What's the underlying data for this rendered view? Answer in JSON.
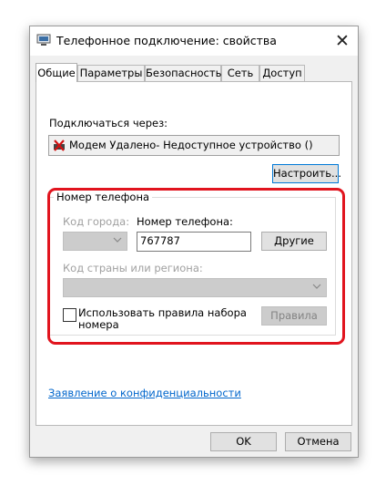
{
  "window": {
    "title": "Телефонное подключение: свойства",
    "close_glyph": "✕"
  },
  "tabs": [
    {
      "label": "Общие",
      "active": true
    },
    {
      "label": "Параметры",
      "active": false
    },
    {
      "label": "Безопасность",
      "active": false
    },
    {
      "label": "Сеть",
      "active": false
    },
    {
      "label": "Доступ",
      "active": false
    }
  ],
  "general": {
    "connect_via_label": "Подключаться через:",
    "device": "Модем Удалено- Недоступное устройство ()",
    "configure_button": "Настроить...",
    "phone_group": {
      "title": "Номер телефона",
      "area_code_label": "Код города:",
      "area_code_value": "",
      "phone_label": "Номер телефона:",
      "phone_value": "767787",
      "alternates_button": "Другие",
      "country_label": "Код страны или региона:",
      "country_value": "",
      "dialing_rules_checkbox": "Использовать правила набора номера",
      "dialing_rules_line1": "Использовать правила набора",
      "dialing_rules_line2": "номера",
      "dialing_rules_checked": false,
      "rules_button": "Правила"
    },
    "privacy_link": "Заявление о конфиденциальности"
  },
  "footer": {
    "ok_button": "OK",
    "cancel_button": "Отмена"
  },
  "colors": {
    "highlight": "#e1141e",
    "link": "#0066cc",
    "focus": "#0078d7"
  }
}
